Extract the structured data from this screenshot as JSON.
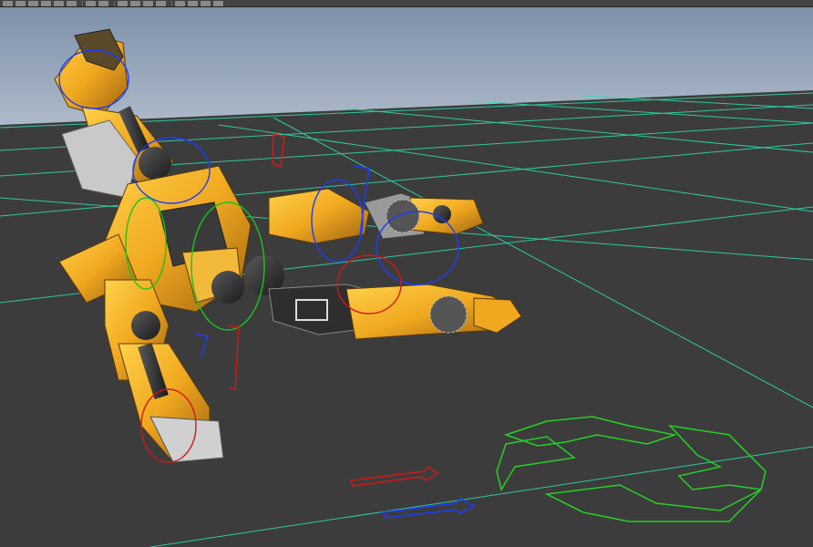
{
  "app": {
    "type": "3D modeling viewport",
    "view": "perspective"
  },
  "toolbar": {
    "icons": [
      "select-tool-icon",
      "lasso-tool-icon",
      "paint-tool-icon",
      "move-tool-icon",
      "rotate-tool-icon",
      "scale-tool-icon",
      "show-manipulator-icon",
      "last-tool-icon",
      "snap-grid-icon",
      "snap-curve-icon",
      "snap-point-icon",
      "snap-surface-icon",
      "history-icon",
      "render-icon",
      "ipr-render-icon",
      "render-settings-icon"
    ]
  },
  "viewport": {
    "colors": {
      "sky_top": "#7d90a9",
      "sky_bottom": "#b9c4d2",
      "ground": "#3c3c3c",
      "grid": "#2fe0b0",
      "robot_yellow": "#f0a820",
      "control_blue": "#1b3cff",
      "control_red": "#d01818",
      "control_green": "#19c419",
      "ik_handle_green": "#25d025"
    },
    "objects": [
      "robot-model",
      "ik-controls",
      "master-control-arrows",
      "axis-gizmo"
    ]
  }
}
